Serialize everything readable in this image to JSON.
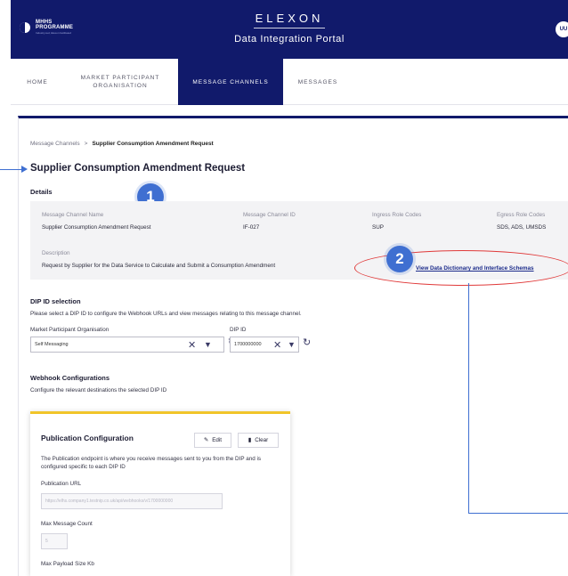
{
  "header": {
    "logo_line1": "MHHS",
    "logo_line2": "PROGRAMME",
    "logo_tagline": "Industry-led, Elexon facilitated",
    "brand": "ELEXON",
    "subtitle": "Data Integration Portal",
    "user_initials": "UU"
  },
  "nav": {
    "items": [
      {
        "label": "HOME"
      },
      {
        "label": "MARKET PARTICIPANT ORGANISATION"
      },
      {
        "label": "MESSAGE CHANNELS",
        "active": true
      },
      {
        "label": "MESSAGES"
      }
    ]
  },
  "breadcrumb": {
    "parent": "Message Channels",
    "separator": ">",
    "current": "Supplier Consumption Amendment Request"
  },
  "page_title": "Supplier Consumption Amendment Request",
  "details": {
    "heading": "Details",
    "message_channel_name_label": "Message Channel Name",
    "message_channel_name": "Supplier Consumption Amendment Request",
    "message_channel_id_label": "Message Channel ID",
    "message_channel_id": "IF-027",
    "ingress_label": "Ingress Role Codes",
    "ingress_value": "SUP",
    "egress_label": "Egress Role Codes",
    "egress_value": "SDS, ADS, UMSDS",
    "description_label": "Description",
    "description": "Request by Supplier for the Data Service to Calculate and Submit a Consumption Amendment",
    "link": "View Data Dictionary and Interface Schemas"
  },
  "annotations": {
    "badge1": "1",
    "badge2": "2",
    "accent": "#3f6fd1",
    "highlight": "#e03a3a"
  },
  "dip_selection": {
    "heading": "DIP ID selection",
    "help": "Please select a DIP ID to configure the Webhook URLs and view messages relating to this message channel.",
    "org_label": "Market Participant Organisation",
    "org_value": "Self Messaging",
    "dip_label": "DIP ID",
    "dip_value": "1700000000"
  },
  "webhook": {
    "heading": "Webhook Configurations",
    "help": "Configure the relevant destinations the selected DIP ID"
  },
  "publication": {
    "title": "Publication Configuration",
    "edit_label": "Edit",
    "clear_label": "Clear",
    "description": "The Publication endpoint is where you receive messages sent to you from the DIP and is configured specific to each DIP ID",
    "url_label": "Publication URL",
    "url_value": "https://elhs.company1.testnip.co.uk/api/webhooks/v/1700000000",
    "max_count_label": "Max Message Count",
    "max_count_value": "5",
    "max_payload_label": "Max Payload Size Kb"
  },
  "colors": {
    "header_bg": "#111a6b",
    "nav_active_bg": "#111a6b",
    "card_accent": "#f1c52a"
  }
}
